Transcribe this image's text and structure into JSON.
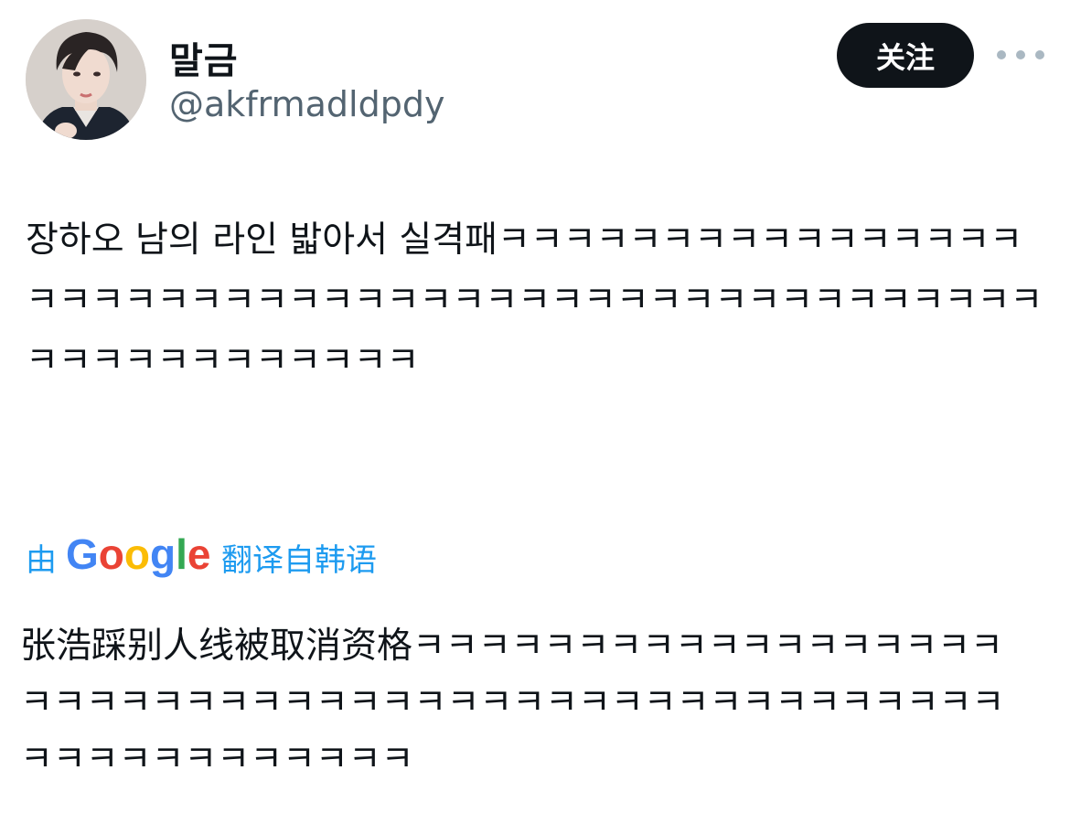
{
  "tweet": {
    "display_name": "말금",
    "handle": "@akfrmadldpdy",
    "follow_label": "关注",
    "more_icon": "more-horizontal-icon",
    "text": "장하오 남의 라인 밟아서 실격패ㅋㅋㅋㅋㅋㅋㅋㅋㅋㅋㅋㅋㅋㅋㅋㅋㅋㅋㅋㅋㅋㅋㅋㅋㅋㅋㅋㅋㅋㅋㅋㅋㅋㅋㅋㅋㅋㅋㅋㅋㅋㅋㅋㅋㅋㅋㅋㅋㅋㅋㅋㅋㅋㅋㅋㅋㅋㅋㅋ",
    "translation": {
      "prefix": "由",
      "brand": "Google",
      "suffix": "翻译自韩语",
      "text": "张浩踩别人线被取消资格ㅋㅋㅋㅋㅋㅋㅋㅋㅋㅋㅋㅋㅋㅋㅋㅋㅋㅋㅋㅋㅋㅋㅋㅋㅋㅋㅋㅋㅋㅋㅋㅋㅋㅋㅋㅋㅋㅋㅋㅋㅋㅋㅋㅋㅋㅋㅋㅋㅋㅋㅋㅋㅋㅋㅋㅋㅋㅋㅋㅋ"
    }
  },
  "colors": {
    "follow_bg": "#0f1419",
    "handle": "#536471",
    "translate_link": "#1d9bf0",
    "google_blue": "#4285F4",
    "google_red": "#EA4335",
    "google_yellow": "#FBBC05",
    "google_green": "#34A853"
  }
}
